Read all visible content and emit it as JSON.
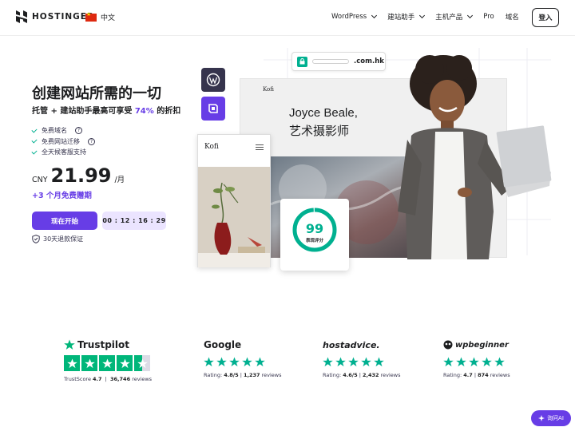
{
  "header": {
    "brand": "HOSTINGER",
    "language": "中文",
    "menu": [
      {
        "label": "WordPress",
        "has_dropdown": true
      },
      {
        "label": "建站助手",
        "has_dropdown": true
      },
      {
        "label": "主机产品",
        "has_dropdown": true
      },
      {
        "label": "Pro",
        "has_dropdown": false
      },
      {
        "label": "域名",
        "has_dropdown": false
      }
    ],
    "login_label": "登入"
  },
  "hero": {
    "title": "创建网站所需的一切",
    "subtitle_prefix": "托管 + 建站助手最高可享受 ",
    "subtitle_highlight": "74%",
    "subtitle_suffix": " 的折扣",
    "features": [
      {
        "label": "免费域名",
        "has_help": true
      },
      {
        "label": "免费网站迁移",
        "has_help": true
      },
      {
        "label": "全天候客服支持",
        "has_help": false
      }
    ],
    "currency": "CNY",
    "price": "21.99",
    "period": "/月",
    "bonus": "+3 个月免费赠期",
    "cta_label": "现在开始",
    "countdown": "00 : 12 : 16 : 29",
    "guarantee": "30天退款保证"
  },
  "illustration": {
    "domain_suffix": ".com.hk",
    "site_logo": "Kofi",
    "site_person_name": "Joyce Beale,",
    "site_person_role": "艺术摄影师",
    "mobile_logo": "Kofi",
    "score_value": "99",
    "score_label": "表现评分",
    "score_fraction": 0.99
  },
  "reviews": [
    {
      "brand": "Trustpilot",
      "score_label": "TrustScore",
      "score": "4.7",
      "count": "36,746",
      "count_label": "reviews",
      "rating": 4.5
    },
    {
      "brand": "Google",
      "score_label": "Rating:",
      "score": "4.8/5",
      "count": "1,237",
      "count_label": "reviews",
      "rating": 5
    },
    {
      "brand": "hostadvice.",
      "score_label": "Rating:",
      "score": "4.6/5",
      "count": "2,432",
      "count_label": "reviews",
      "rating": 5
    },
    {
      "brand": "wpbeginner",
      "score_label": "Rating:",
      "score": "4.7",
      "count": "874",
      "count_label": "reviews",
      "rating": 5
    }
  ],
  "ask_ai_label": "询问AI",
  "colors": {
    "accent": "#673de6",
    "accent_light": "#ebe4ff",
    "green": "#00b090",
    "trustpilot": "#00b67a",
    "wordpress_button": "#2f1c6a"
  }
}
